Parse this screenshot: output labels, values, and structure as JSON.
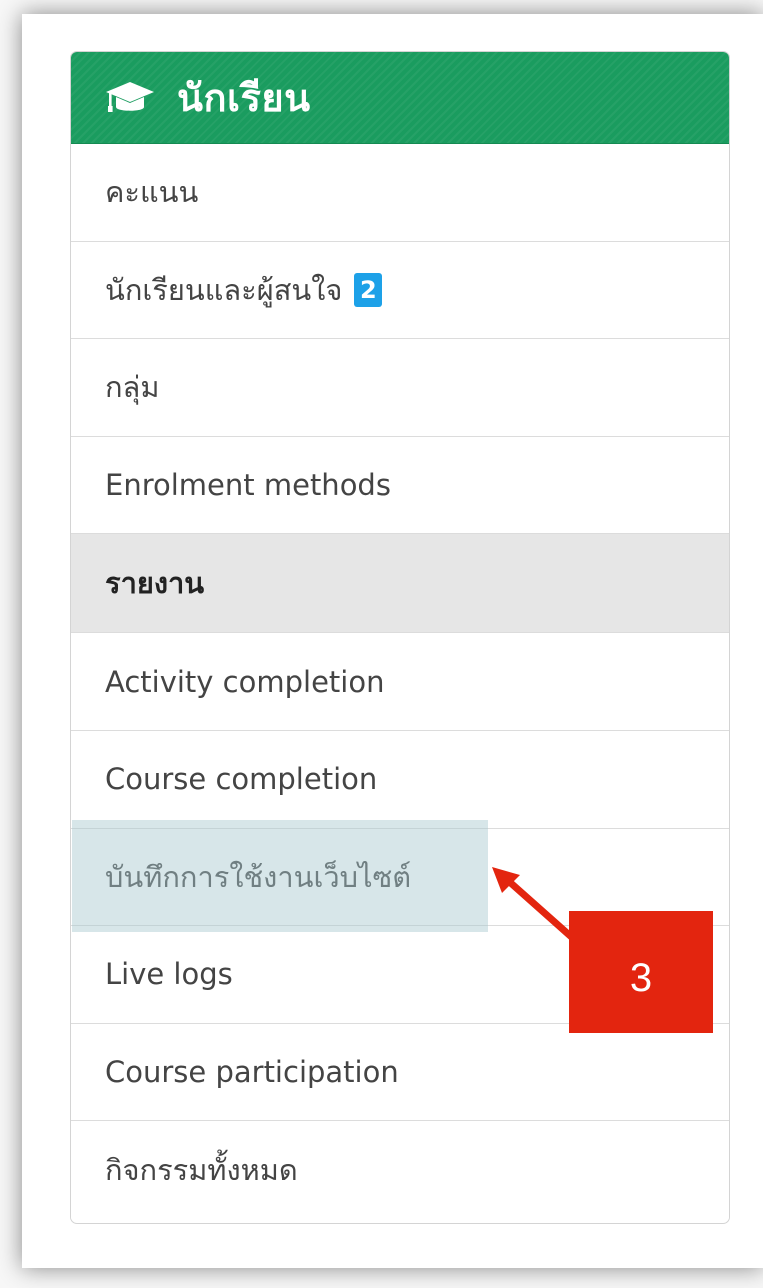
{
  "panel": {
    "header": {
      "title": "นักเรียน",
      "icon": "graduation-cap-icon",
      "color": "#1a9c5f"
    },
    "items": [
      {
        "label": "คะแนน"
      },
      {
        "label": "นักเรียนและผู้สนใจ",
        "badge": "2"
      },
      {
        "label": "กลุ่ม"
      },
      {
        "label": "Enrolment methods"
      },
      {
        "label": "รายงาน",
        "type": "section"
      },
      {
        "label": "Activity completion"
      },
      {
        "label": "Course completion"
      },
      {
        "label": "บันทึกการใช้งานเว็บไซต์",
        "highlighted": true
      },
      {
        "label": "Live logs"
      },
      {
        "label": "Course participation"
      },
      {
        "label": "กิจกรรมทั้งหมด"
      }
    ]
  },
  "annotation": {
    "step_label": "3",
    "callout_color": "#e3250f",
    "highlight_color": "#a6c8ce"
  }
}
